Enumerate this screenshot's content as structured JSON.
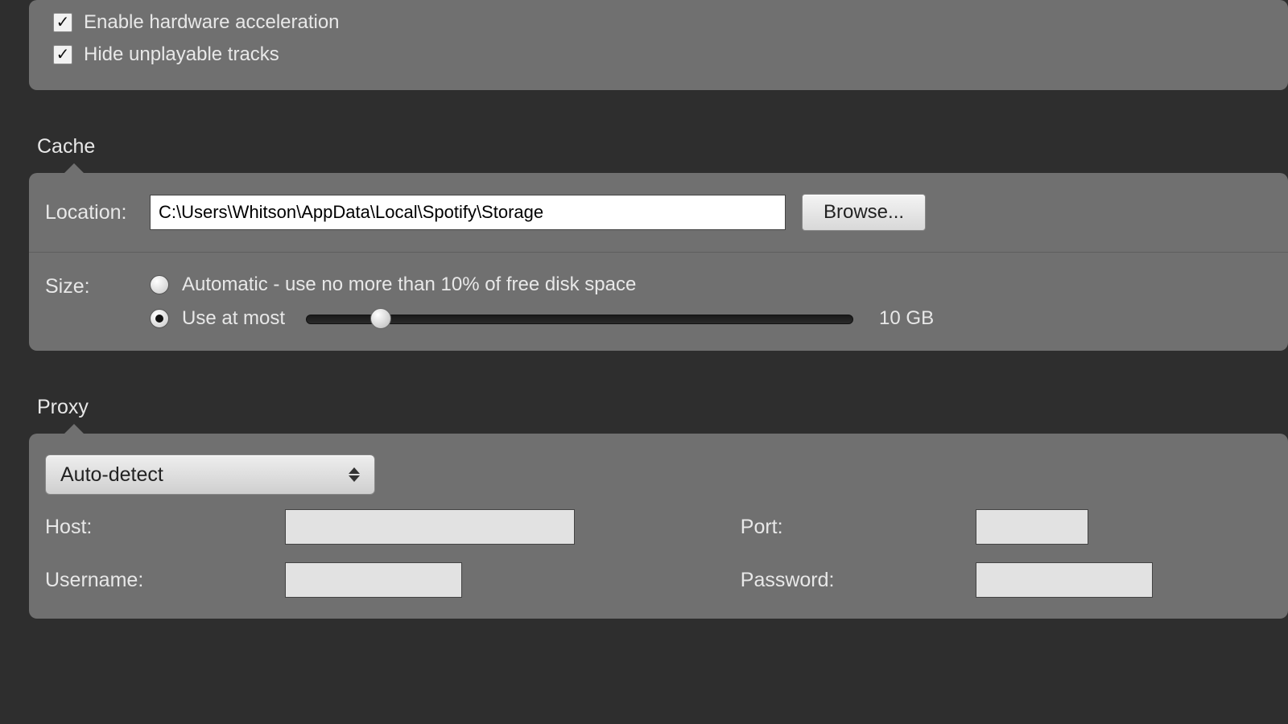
{
  "general": {
    "hw_accel_label": "Enable hardware acceleration",
    "hw_accel_checked": true,
    "hide_tracks_label": "Hide unplayable tracks",
    "hide_tracks_checked": true
  },
  "cache": {
    "section_title": "Cache",
    "location_label": "Location:",
    "location_value": "C:\\Users\\Whitson\\AppData\\Local\\Spotify\\Storage",
    "browse_label": "Browse...",
    "size_label": "Size:",
    "auto_label": "Automatic - use no more than 10% of free disk space",
    "use_at_most_label": "Use at most",
    "slider_value_label": "10 GB",
    "selected_option": "use_at_most"
  },
  "proxy": {
    "section_title": "Proxy",
    "mode_selected": "Auto-detect",
    "host_label": "Host:",
    "host_value": "",
    "port_label": "Port:",
    "port_value": "",
    "username_label": "Username:",
    "username_value": "",
    "password_label": "Password:",
    "password_value": ""
  }
}
